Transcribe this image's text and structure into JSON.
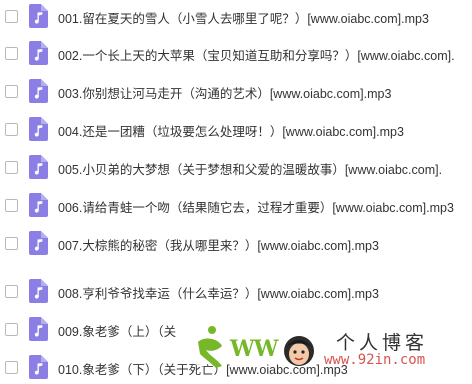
{
  "files": [
    {
      "name": "001.留在夏天的雪人（小雪人去哪里了呢？）[www.oiabc.com].mp3",
      "checked": false
    },
    {
      "name": "002.一个长上天的大苹果（宝贝知道互助和分享吗？）[www.oiabc.com].",
      "checked": false
    },
    {
      "name": "003.你别想让河马走开（沟通的艺术）[www.oiabc.com].mp3",
      "checked": false
    },
    {
      "name": "004.还是一团糟（垃圾要怎么处理呀！）[www.oiabc.com].mp3",
      "checked": false
    },
    {
      "name": "005.小贝弟的大梦想（关于梦想和父爱的温暖故事）[www.oiabc.com].",
      "checked": false
    },
    {
      "name": "006.请给青蛙一个吻（结果随它去，过程才重要）[www.oiabc.com].mp3",
      "checked": false
    },
    {
      "name": "007.大棕熊的秘密（我从哪里来？）[www.oiabc.com].mp3",
      "checked": false
    },
    {
      "name": "008.亨利爷爷找幸运（什么幸运？）[www.oiabc.com].mp3",
      "checked": false
    },
    {
      "name": "009.象老爹（上）（关",
      "checked": false
    },
    {
      "name": "010.象老爹（下）（关于死亡）[www.oiabc.com].mp3",
      "checked": false
    }
  ],
  "file_icon": {
    "name": "music-note-icon",
    "color": "#8b7fe6"
  },
  "watermark": {
    "logo_letters": "WW",
    "title": "个人博客",
    "url": "www.92in.com"
  }
}
